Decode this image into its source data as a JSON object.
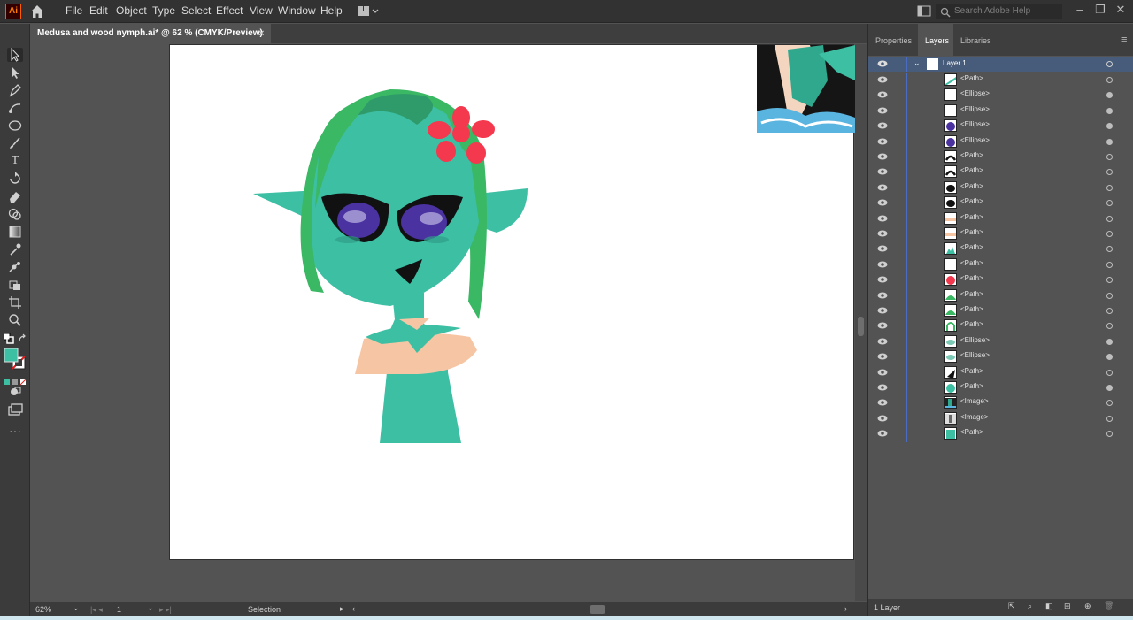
{
  "app": {
    "logo_text": "Ai"
  },
  "menu": {
    "items": [
      "File",
      "Edit",
      "Object",
      "Type",
      "Select",
      "Effect",
      "View",
      "Window",
      "Help"
    ]
  },
  "search": {
    "placeholder": "Search Adobe Help"
  },
  "document": {
    "tab_title": "Medusa and wood nymph.ai* @ 62 % (CMYK/Preview)",
    "close_glyph": "×"
  },
  "status": {
    "zoom": "62%",
    "artboard_number": "1",
    "mode": "Selection"
  },
  "panel": {
    "tabs": [
      "Properties",
      "Layers",
      "Libraries"
    ],
    "active_tab": "Layers",
    "layer_name": "Layer 1",
    "footer_count": "1 Layer",
    "rows": [
      {
        "name": "<Path>",
        "thumb": "path-green-diag",
        "target_filled": false
      },
      {
        "name": "<Ellipse>",
        "thumb": "blank",
        "target_filled": true
      },
      {
        "name": "<Ellipse>",
        "thumb": "blank",
        "target_filled": true
      },
      {
        "name": "<Ellipse>",
        "thumb": "purple-circle",
        "target_filled": true
      },
      {
        "name": "<Ellipse>",
        "thumb": "purple-circle",
        "target_filled": true
      },
      {
        "name": "<Path>",
        "thumb": "black-arc",
        "target_filled": false
      },
      {
        "name": "<Path>",
        "thumb": "black-arc",
        "target_filled": false
      },
      {
        "name": "<Path>",
        "thumb": "black-blob",
        "target_filled": false
      },
      {
        "name": "<Path>",
        "thumb": "black-blob",
        "target_filled": false
      },
      {
        "name": "<Path>",
        "thumb": "peach-band",
        "target_filled": false
      },
      {
        "name": "<Path>",
        "thumb": "peach-band",
        "target_filled": false
      },
      {
        "name": "<Path>",
        "thumb": "teal-mound",
        "target_filled": false
      },
      {
        "name": "<Path>",
        "thumb": "blank",
        "target_filled": false
      },
      {
        "name": "<Path>",
        "thumb": "red-flower",
        "target_filled": false
      },
      {
        "name": "<Path>",
        "thumb": "green-mound",
        "target_filled": false
      },
      {
        "name": "<Path>",
        "thumb": "green-mound",
        "target_filled": false
      },
      {
        "name": "<Path>",
        "thumb": "green-arch",
        "target_filled": false
      },
      {
        "name": "<Ellipse>",
        "thumb": "teal-ellipse",
        "target_filled": true
      },
      {
        "name": "<Ellipse>",
        "thumb": "teal-ellipse",
        "target_filled": true
      },
      {
        "name": "<Path>",
        "thumb": "black-wedge",
        "target_filled": false
      },
      {
        "name": "<Path>",
        "thumb": "teal-circle",
        "target_filled": true
      },
      {
        "name": "<Image>",
        "thumb": "image-dark",
        "target_filled": false
      },
      {
        "name": "<Image>",
        "thumb": "image-light",
        "target_filled": false
      },
      {
        "name": "<Path>",
        "thumb": "teal-square",
        "target_filled": false
      }
    ]
  },
  "colors": {
    "skin": "#3dbfa4",
    "hair": "#3ab864",
    "flower": "#f4384d",
    "collar": "#f6c6a4",
    "eye_iris": "#4a32a0",
    "accent_layer": "#4b6cc3"
  }
}
